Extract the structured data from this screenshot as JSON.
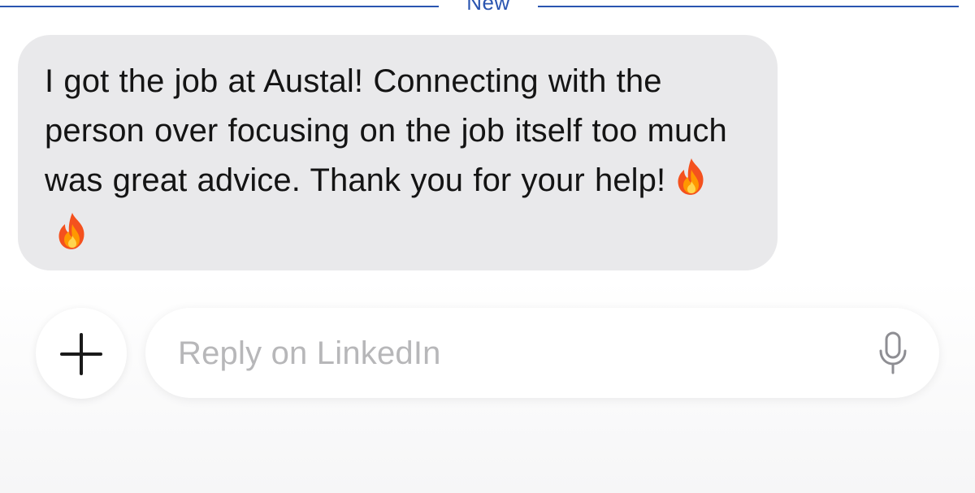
{
  "divider": {
    "label": "New",
    "color": "#2a55b0"
  },
  "message": {
    "text": "I got the job at Austal! Connecting with the person over focusing on the job itself too much was great advice. Thank you for your help!",
    "emojis": [
      "fire-emoji",
      "fire-emoji"
    ],
    "bubble_color": "#e9e9eb"
  },
  "composer": {
    "add_icon": "plus-icon",
    "placeholder": "Reply on LinkedIn",
    "mic_icon": "microphone-icon"
  }
}
